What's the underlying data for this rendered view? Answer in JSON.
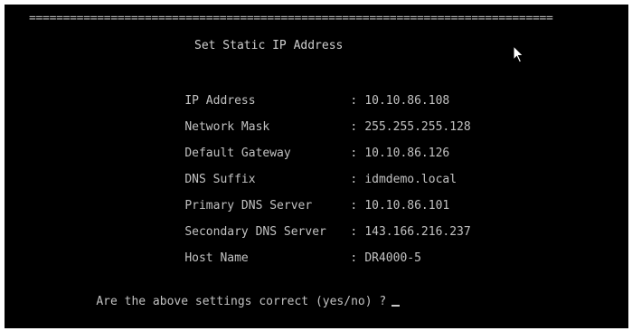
{
  "separator": "=============================================================================",
  "title": "Set Static IP Address",
  "fields": [
    {
      "label": "IP Address",
      "separator": ":",
      "value": "10.10.86.108"
    },
    {
      "label": "Network Mask",
      "separator": ":",
      "value": "255.255.255.128"
    },
    {
      "label": "Default Gateway",
      "separator": ":",
      "value": "10.10.86.126"
    },
    {
      "label": "DNS Suffix",
      "separator": ":",
      "value": "idmdemo.local"
    },
    {
      "label": "Primary DNS Server",
      "separator": ":",
      "value": "10.10.86.101"
    },
    {
      "label": "Secondary DNS Server",
      "separator": ":",
      "value": "143.166.216.237"
    },
    {
      "label": "Host Name",
      "separator": ":",
      "value": "DR4000-5"
    }
  ],
  "prompt": "Are the above settings correct (yes/no) ?",
  "colors": {
    "background": "#000000",
    "text": "#c2c2c2"
  }
}
